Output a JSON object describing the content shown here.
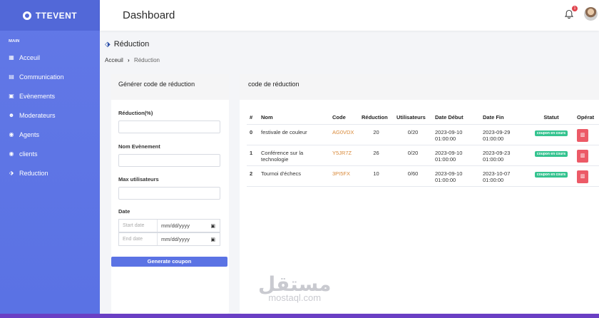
{
  "brand": {
    "name": "TTEVENT"
  },
  "sidebar": {
    "section": "MAIN",
    "items": [
      {
        "label": "Acceuil",
        "icon": "grid-icon"
      },
      {
        "label": "Communication",
        "icon": "message-icon"
      },
      {
        "label": "Evènements",
        "icon": "calendar-icon"
      },
      {
        "label": "Moderateurs",
        "icon": "user-icon"
      },
      {
        "label": "Agents",
        "icon": "agent-icon"
      },
      {
        "label": "clients",
        "icon": "client-icon"
      },
      {
        "label": "Reduction",
        "icon": "tag-icon"
      }
    ]
  },
  "header": {
    "title": "Dashboard",
    "notification_count": "1"
  },
  "page": {
    "title": "Réduction",
    "breadcrumb": {
      "home": "Acceuil",
      "current": "Réduction"
    }
  },
  "form": {
    "title": "Générer code de réduction",
    "reduction_label": "Réduction(%)",
    "reduction_value": "",
    "event_label": "Nom Evènement",
    "event_value": "",
    "max_users_label": "Max utilisateurs",
    "max_users_value": "",
    "date_label": "Date",
    "start_label": "Start date",
    "start_value": "mm/dd/yyyy",
    "end_label": "End date",
    "end_value": "mm/dd/yyyy",
    "submit_label": "Generate coupon"
  },
  "table": {
    "title": "code de réduction",
    "columns": [
      "#",
      "Nom",
      "Code",
      "Réduction",
      "Utilisateurs",
      "Date Début",
      "Date Fin",
      "Statut",
      "Opérat"
    ],
    "rows": [
      {
        "idx": "0",
        "nom": "festivale de couleur",
        "code": "AG0VDX",
        "reduction": "20",
        "users": "0/20",
        "debut": "2023-09-10 01:00:00",
        "fin": "2023-09-29 01:00:00",
        "statut": "coupon en cours"
      },
      {
        "idx": "1",
        "nom": "Conférence sur la technologie",
        "code": "Y5JR7Z",
        "reduction": "26",
        "users": "0/20",
        "debut": "2023-09-10 01:00:00",
        "fin": "2023-09-23 01:00:00",
        "statut": "coupon en cours"
      },
      {
        "idx": "2",
        "nom": "Tournoi d'échecs",
        "code": "3PI5FX",
        "reduction": "10",
        "users": "0/60",
        "debut": "2023-09-10 01:00:00",
        "fin": "2023-10-07 01:00:00",
        "statut": "coupon en cours"
      }
    ]
  },
  "watermark": {
    "arabic": "مستقل",
    "latin": "mostaql.com"
  }
}
